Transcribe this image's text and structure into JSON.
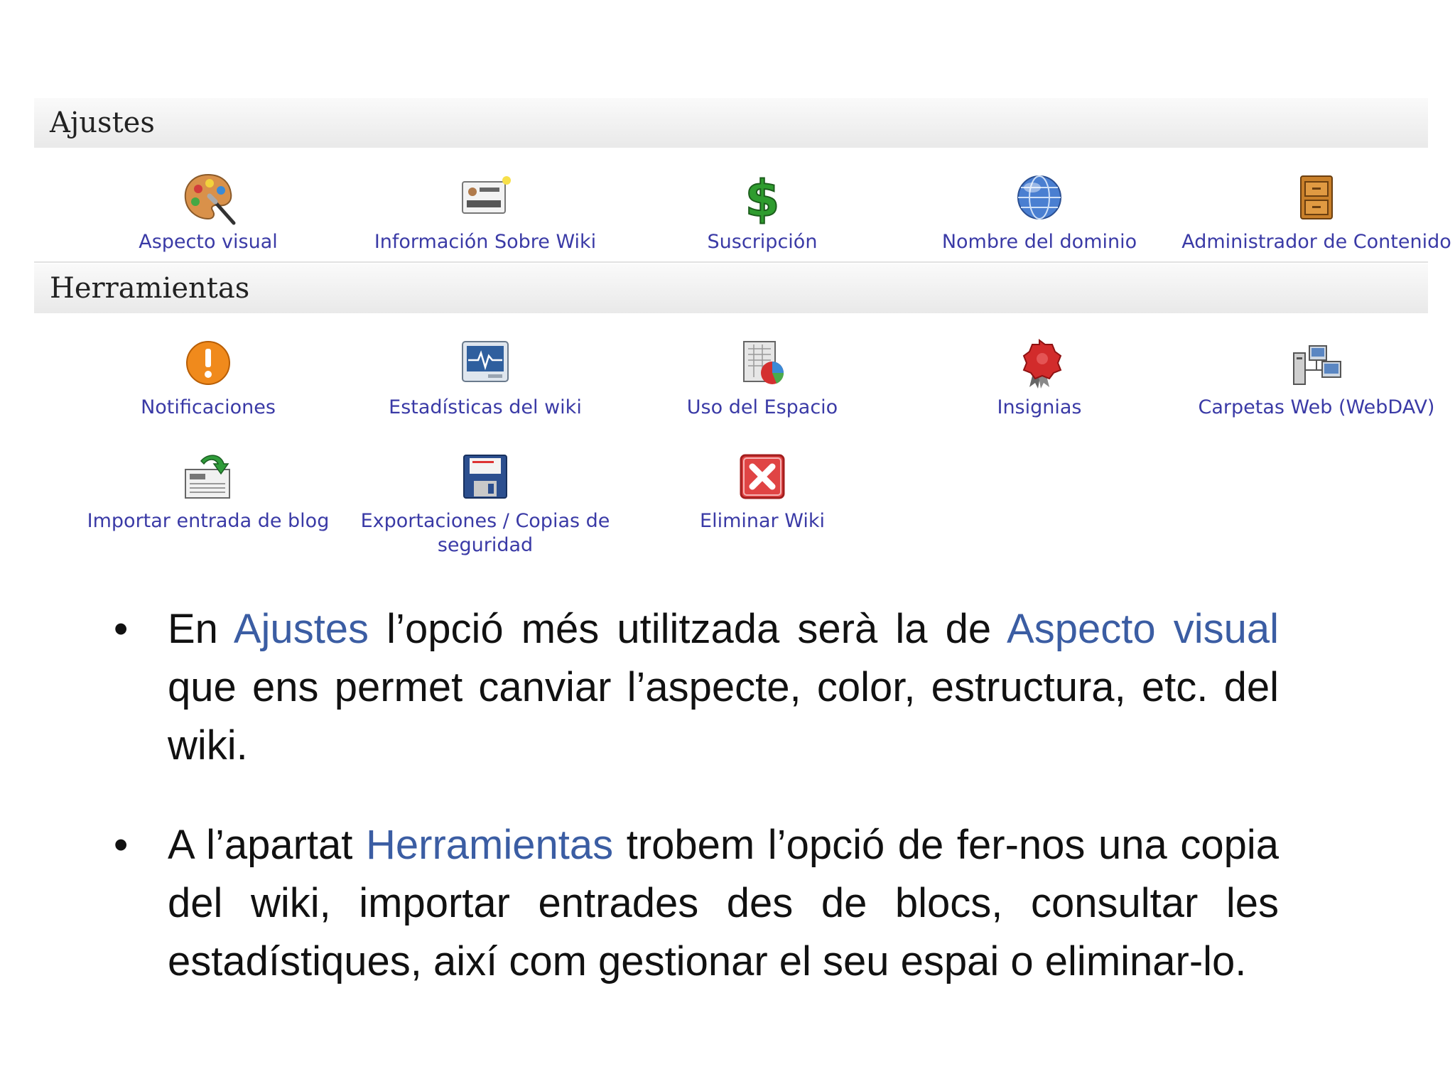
{
  "sections": {
    "ajustes": {
      "title": "Ajustes",
      "items": [
        {
          "label": "Aspecto visual",
          "icon": "palette-icon"
        },
        {
          "label": "Información Sobre Wiki",
          "icon": "id-card-icon"
        },
        {
          "label": "Suscripción",
          "icon": "dollar-icon"
        },
        {
          "label": "Nombre del dominio",
          "icon": "globe-icon"
        },
        {
          "label": "Administrador de Contenido",
          "icon": "file-cabinet-icon"
        }
      ]
    },
    "herramientas": {
      "title": "Herramientas",
      "items": [
        {
          "label": "Notificaciones",
          "icon": "alert-icon"
        },
        {
          "label": "Estadísticas del wiki",
          "icon": "monitor-chart-icon"
        },
        {
          "label": "Uso del Espacio",
          "icon": "pie-chart-icon"
        },
        {
          "label": "Insignias",
          "icon": "seal-badge-icon"
        },
        {
          "label": "Carpetas Web (WebDAV)",
          "icon": "network-computers-icon"
        },
        {
          "label": "Importar entrada de blog",
          "icon": "import-news-icon"
        },
        {
          "label": "Exportaciones / Copias de seguridad",
          "icon": "floppy-disk-icon"
        },
        {
          "label": "Eliminar Wiki",
          "icon": "delete-icon"
        }
      ]
    }
  },
  "bullets": {
    "b1": {
      "p1": "En ",
      "h1": "Ajustes",
      "p2": " l’opció més utilitzada serà la de ",
      "h2": "Aspecto visual",
      "p3": " que ens permet canviar l’aspecte, color, estructura, etc. del wiki."
    },
    "b2": {
      "p1": "A l’apartat ",
      "h1": "Herramientas",
      "p2": " trobem l’opció de fer-nos una copia del wiki, importar entrades des de blocs, consultar les estadístiques, així com gestionar el seu espai o eliminar-lo."
    }
  },
  "colors": {
    "link": "#3a3aa6",
    "highlight": "#3b5da3",
    "header_bg": "#e9e9e9"
  }
}
